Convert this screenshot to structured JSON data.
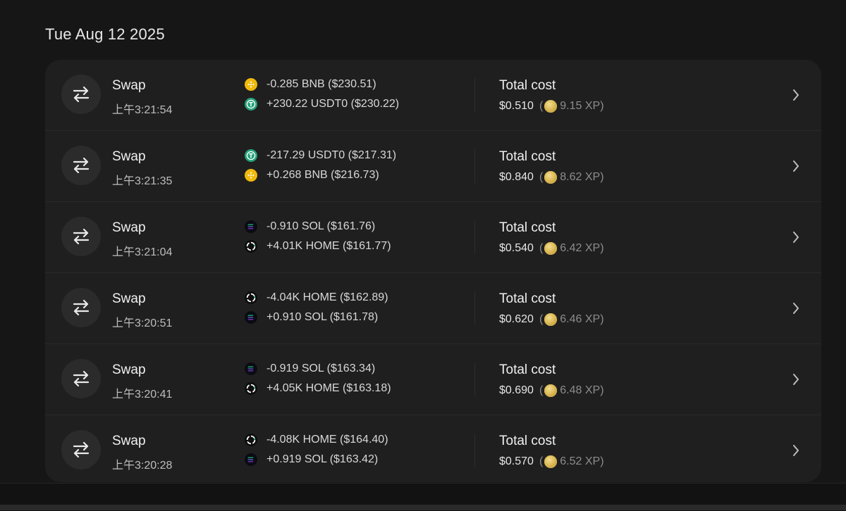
{
  "date_heading": "Tue Aug 12 2025",
  "colors": {
    "bnb": "#f0b90b",
    "usdt0": "#26a17b",
    "sol": "#9945ff",
    "home": "#3ad0b4",
    "xp_coin": "#d8b450"
  },
  "transactions": [
    {
      "type": "Swap",
      "time": "上午3:21:54",
      "assets": [
        {
          "icon": "bnb-token-icon",
          "text": "-0.285 BNB ($230.51)"
        },
        {
          "icon": "usdt0-token-icon",
          "text": "+230.22 USDT0 ($230.22)"
        }
      ],
      "cost_title": "Total cost",
      "cost": "$0.510",
      "xp": "9.15 XP"
    },
    {
      "type": "Swap",
      "time": "上午3:21:35",
      "assets": [
        {
          "icon": "usdt0-token-icon",
          "text": "-217.29 USDT0 ($217.31)"
        },
        {
          "icon": "bnb-token-icon",
          "text": "+0.268 BNB ($216.73)"
        }
      ],
      "cost_title": "Total cost",
      "cost": "$0.840",
      "xp": "8.62 XP"
    },
    {
      "type": "Swap",
      "time": "上午3:21:04",
      "assets": [
        {
          "icon": "sol-token-icon",
          "text": "-0.910 SOL ($161.76)"
        },
        {
          "icon": "home-token-icon",
          "text": "+4.01K HOME ($161.77)"
        }
      ],
      "cost_title": "Total cost",
      "cost": "$0.540",
      "xp": "6.42 XP"
    },
    {
      "type": "Swap",
      "time": "上午3:20:51",
      "assets": [
        {
          "icon": "home-token-icon",
          "text": "-4.04K HOME ($162.89)"
        },
        {
          "icon": "sol-token-icon",
          "text": "+0.910 SOL ($161.78)"
        }
      ],
      "cost_title": "Total cost",
      "cost": "$0.620",
      "xp": "6.46 XP"
    },
    {
      "type": "Swap",
      "time": "上午3:20:41",
      "assets": [
        {
          "icon": "sol-token-icon",
          "text": "-0.919 SOL ($163.34)"
        },
        {
          "icon": "home-token-icon",
          "text": "+4.05K HOME ($163.18)"
        }
      ],
      "cost_title": "Total cost",
      "cost": "$0.690",
      "xp": "6.48 XP"
    },
    {
      "type": "Swap",
      "time": "上午3:20:28",
      "assets": [
        {
          "icon": "home-token-icon",
          "text": "-4.08K HOME ($164.40)"
        },
        {
          "icon": "sol-token-icon",
          "text": "+0.919 SOL ($163.42)"
        }
      ],
      "cost_title": "Total cost",
      "cost": "$0.570",
      "xp": "6.52 XP"
    }
  ]
}
